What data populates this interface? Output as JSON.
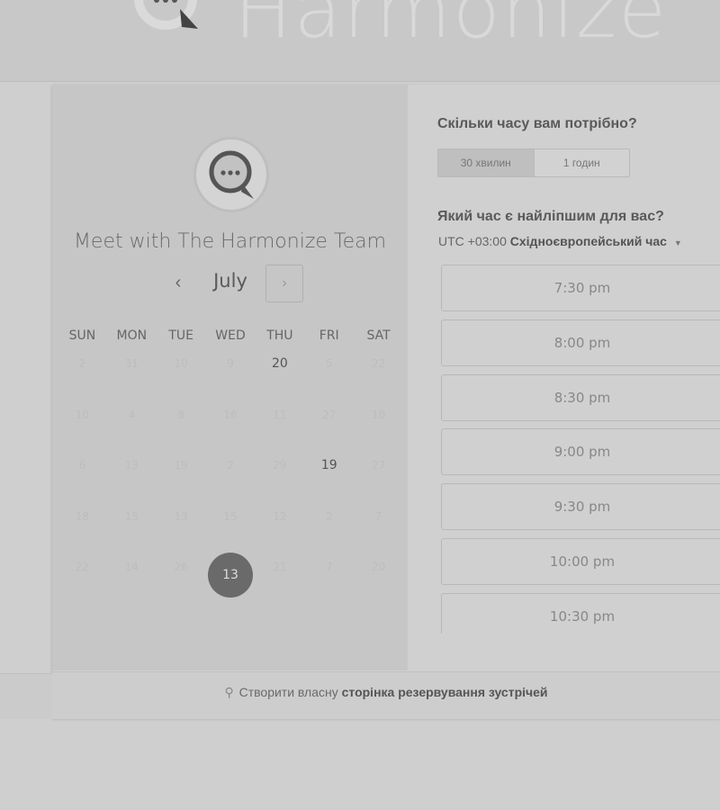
{
  "brand": {
    "name": "Harmonize"
  },
  "meeting": {
    "title": "Meet with The Harmonize Team"
  },
  "calendar": {
    "month": "July",
    "prev_icon": "chevron-left",
    "next_icon": "chevron-right",
    "weekdays": [
      "SUN",
      "MON",
      "TUE",
      "WED",
      "THU",
      "FRI",
      "SAT"
    ],
    "weeks": [
      [
        "2",
        "31",
        "10",
        "9",
        "20",
        "5",
        "22"
      ],
      [
        "10",
        "4",
        "8",
        "16",
        "11",
        "27",
        "10"
      ],
      [
        "6",
        "13",
        "19",
        "2",
        "29",
        "19",
        "27"
      ],
      [
        "18",
        "15",
        "13",
        "15",
        "12",
        "2",
        "7"
      ],
      [
        "22",
        "14",
        "26",
        "13",
        "21",
        "7",
        "20"
      ]
    ],
    "available_days": [
      "20",
      "19"
    ],
    "selected_day": "13"
  },
  "duration": {
    "question": "Скільки часу вам потрібно?",
    "options": [
      "30 хвилин",
      "1 годин"
    ],
    "selected": "30 хвилин"
  },
  "time": {
    "question": "Який час є найліпшим для вас?",
    "timezone_offset": "UTC +03:00",
    "timezone_name": "Східноєвропейський час",
    "slots": [
      "7:30 pm",
      "8:00 pm",
      "8:30 pm",
      "9:00 pm",
      "9:30 pm",
      "10:00 pm",
      "10:30 pm"
    ]
  },
  "footer": {
    "prefix": "Створити власну",
    "link": "сторінка резервування зустрічей"
  }
}
